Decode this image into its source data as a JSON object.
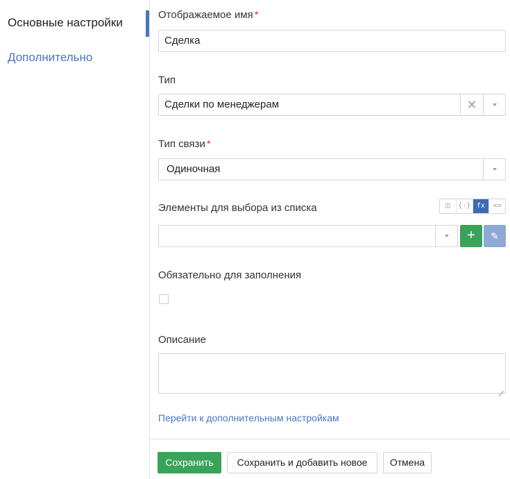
{
  "sidebar": {
    "items": [
      {
        "label": "Основные настройки",
        "active": true
      },
      {
        "label": "Дополнительно",
        "active": false
      }
    ]
  },
  "form": {
    "display_name": {
      "label": "Отображаемое имя",
      "required_mark": "*",
      "value": "Сделка"
    },
    "type": {
      "label": "Тип",
      "value": "Сделки по менеджерам",
      "clear_icon": "close-icon"
    },
    "link_type": {
      "label": "Тип связи",
      "required_mark": "*",
      "value": "Одиночная"
    },
    "list_items": {
      "label": "Элементы для выбора из списка",
      "value": "",
      "modes": [
        "◫",
        "{·}",
        "fx",
        "<>"
      ],
      "active_mode": 2,
      "add_icon": "+",
      "edit_icon": "✎"
    },
    "required": {
      "label": "Обязательно для заполнения",
      "checked": false
    },
    "description": {
      "label": "Описание",
      "value": ""
    },
    "advanced_link": "Перейти к дополнительным настройкам"
  },
  "footer": {
    "save_label": "Сохранить",
    "save_and_new_label": "Сохранить и добавить новое",
    "cancel_label": "Отмена"
  },
  "colors": {
    "accent": "#4a76c1",
    "success": "#3aa35a",
    "required": "#d9363e"
  }
}
